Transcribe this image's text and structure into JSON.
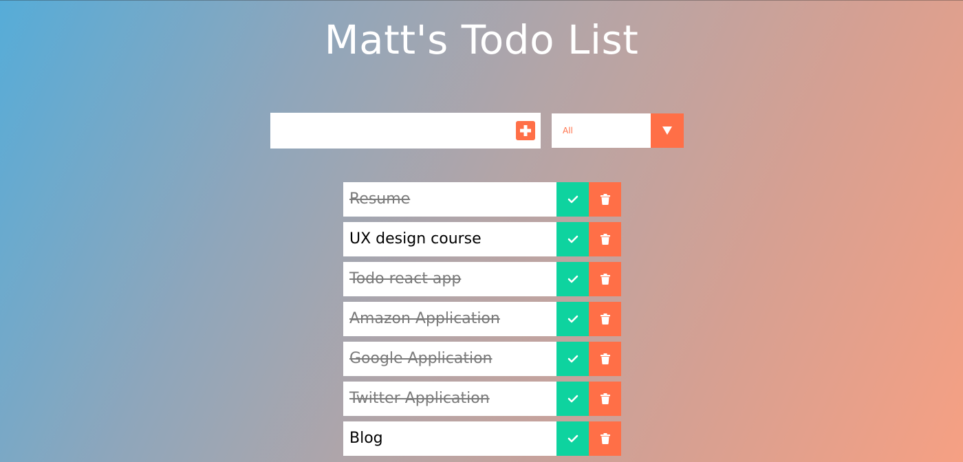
{
  "app": {
    "title": "Matt's Todo List"
  },
  "new_todo": {
    "value": "",
    "placeholder": "",
    "add_icon": "plus-square-icon"
  },
  "filter": {
    "selected": "All",
    "arrow_icon": "triangle-down-icon"
  },
  "todos": [
    {
      "text": "Resume",
      "completed": true
    },
    {
      "text": "UX design course",
      "completed": false
    },
    {
      "text": "Todo react app",
      "completed": true
    },
    {
      "text": "Amazon Application",
      "completed": true
    },
    {
      "text": "Google Application",
      "completed": true
    },
    {
      "text": "Twitter Application",
      "completed": true
    },
    {
      "text": "Blog",
      "completed": false
    }
  ],
  "todo_actions": {
    "complete_icon": "check-icon",
    "delete_icon": "trash-icon"
  },
  "colors": {
    "accent": "#ff6f47",
    "complete": "#0ed39f",
    "text_done": "#7a7a7a"
  }
}
